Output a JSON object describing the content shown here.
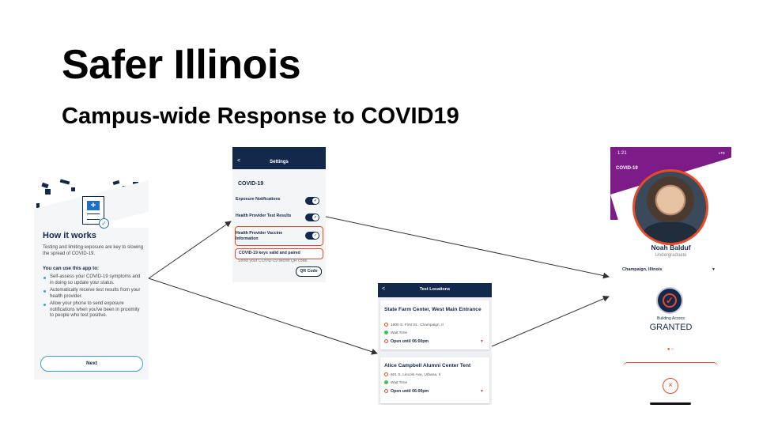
{
  "slide": {
    "title": "Safer Illinois",
    "subtitle": "Campus-wide Response to COVID19"
  },
  "how_it_works": {
    "title": "How it works",
    "intro": "Testing and limiting exposure are key to slowing the spread of COVID-19.",
    "can_use": "You can use this app to:",
    "bullets": [
      "Self-assess your COVID-19 symptoms and in doing so update your status.",
      "Automatically receive test results from your health provider.",
      "Allow your phone to send exposure notifications when you've been in proximity to people who test positive."
    ],
    "next_label": "Next"
  },
  "settings": {
    "title": "Settings",
    "back": "<",
    "section": "COVID-19",
    "rows": [
      {
        "label": "Exposure Notifications",
        "on": true
      },
      {
        "label": "Health Provider Test Results",
        "on": true
      },
      {
        "label": "Health Provider Vaccine Information",
        "on": true
      }
    ],
    "keys_status": "COVID-19 keys valid and paired",
    "secret_text": "Show your COVID-19 secret QR code.",
    "qr_label": "QR Code"
  },
  "test_locations": {
    "title": "Test Locations",
    "back": "<",
    "cards": [
      {
        "name": "State Farm Center, West Main Entrance",
        "address": "1800 S. First St., Champaign, Il",
        "wait": "Wait Time",
        "open": "Open until 06:00pm"
      },
      {
        "name": "Alice Campbell Alumni Center Tent",
        "address": "601 S. Lincoln Ave, Urbana, Il",
        "wait": "Wait Time",
        "open": "Open until 06:00pm"
      }
    ]
  },
  "profile": {
    "time": "1:21",
    "signal": "LTE",
    "section": "COVID-19",
    "name": "Noah Balduf",
    "role": "Undergraduate",
    "location": "Champaign, Illinois",
    "building_access_label": "Building Access",
    "status": "GRANTED"
  },
  "colors": {
    "navy": "#13294b",
    "orange": "#e84a27",
    "purple": "#7d1c88",
    "blue": "#3b9ed8"
  }
}
